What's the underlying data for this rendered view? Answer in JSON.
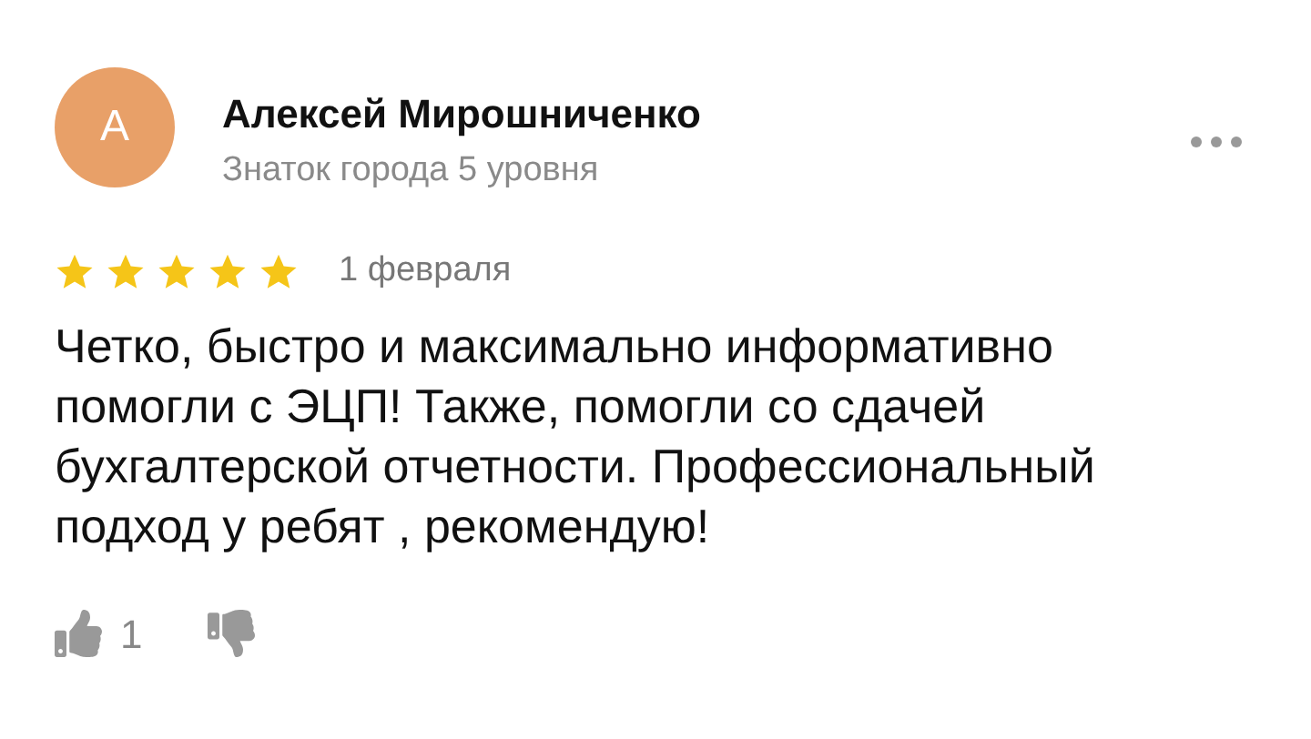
{
  "author": {
    "initial": "А",
    "name": "Алексей Мирошниченко",
    "level": "Знаток города 5 уровня"
  },
  "review": {
    "stars": 5,
    "date": "1 февраля",
    "text": "Четко, быстро и максимально информативно помогли с ЭЦП! Также, помогли со сдачей бухгалтерской отчетности. Профессиональный подход у ребят , рекомендую!"
  },
  "likes": "1"
}
